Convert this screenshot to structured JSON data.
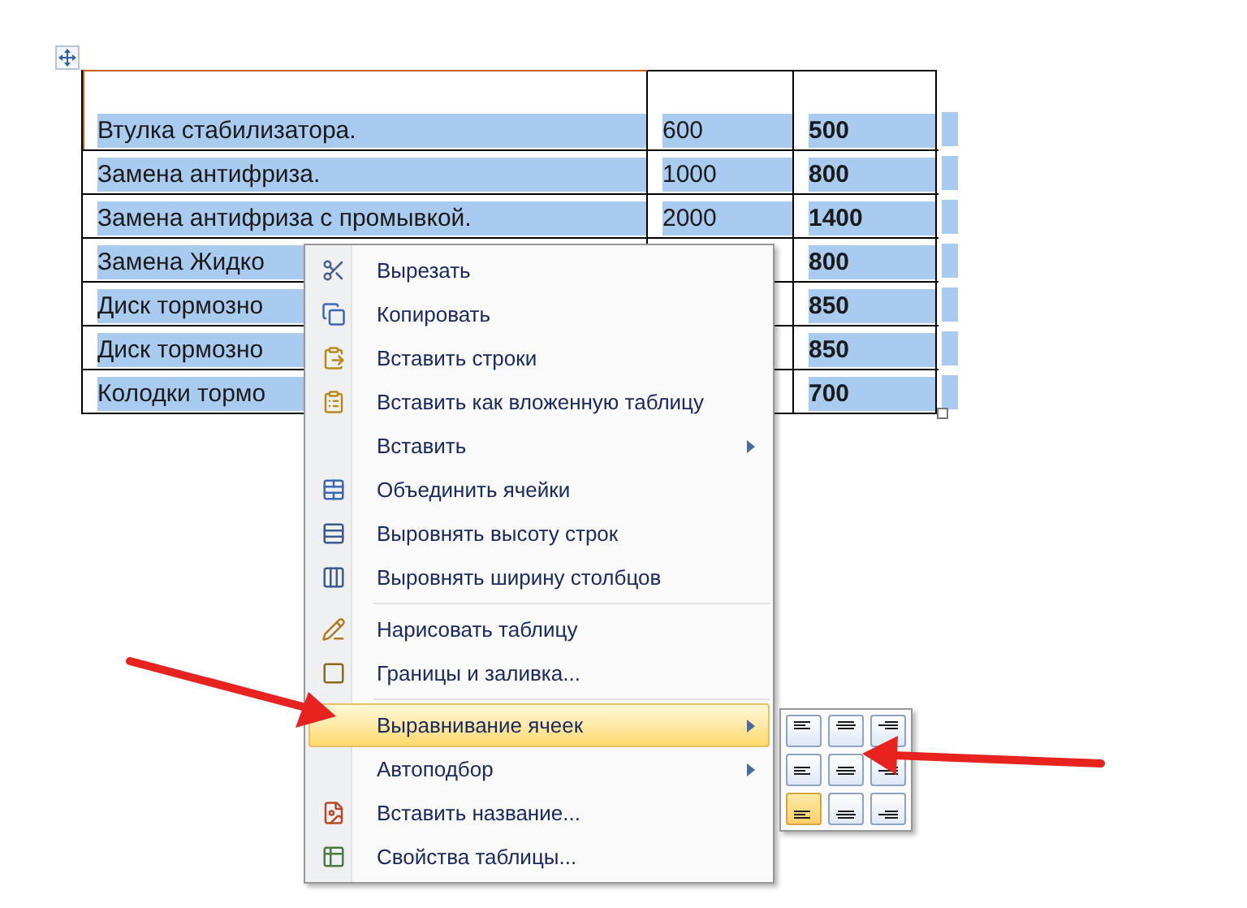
{
  "table": {
    "rows": [
      {
        "name": "Втулка стабилизатора.",
        "price": "600",
        "discount": "500"
      },
      {
        "name": "Замена антифриза.",
        "price": "1000",
        "discount": "800"
      },
      {
        "name": "Замена антифриза с промывкой.",
        "price": "2000",
        "discount": "1400"
      },
      {
        "name": "Замена Жидко",
        "discount": "800"
      },
      {
        "name": "Диск тормозно",
        "discount": "850"
      },
      {
        "name": "Диск тормозно",
        "discount": "850"
      },
      {
        "name": "Колодки тормо",
        "discount": "700"
      }
    ]
  },
  "context_menu": {
    "groups": [
      [
        {
          "label": "Вырезать",
          "submenu": false,
          "selected": false
        },
        {
          "label": "Копировать",
          "submenu": false,
          "selected": false
        },
        {
          "label": "Вставить строки",
          "submenu": false,
          "selected": false
        },
        {
          "label": "Вставить как вложенную таблицу",
          "submenu": false,
          "selected": false
        },
        {
          "label": "Вставить",
          "submenu": true,
          "selected": false
        },
        {
          "label": "Объединить ячейки",
          "submenu": false,
          "selected": false
        },
        {
          "label": "Выровнять высоту строк",
          "submenu": false,
          "selected": false
        },
        {
          "label": "Выровнять ширину столбцов",
          "submenu": false,
          "selected": false
        }
      ],
      [
        {
          "label": "Нарисовать таблицу",
          "submenu": false,
          "selected": false
        },
        {
          "label": "Границы и заливка...",
          "submenu": false,
          "selected": false
        }
      ],
      [
        {
          "label": "Выравнивание ячеек",
          "submenu": true,
          "selected": true
        },
        {
          "label": "Автоподбор",
          "submenu": true,
          "selected": false
        },
        {
          "label": "Вставить название...",
          "submenu": false,
          "selected": false
        },
        {
          "label": "Свойства таблицы...",
          "submenu": false,
          "selected": false
        }
      ]
    ]
  },
  "cell_alignment_submenu": {
    "buttons": [
      {
        "selected": false
      },
      {
        "selected": false
      },
      {
        "selected": false
      },
      {
        "selected": false
      },
      {
        "selected": false
      },
      {
        "selected": false
      },
      {
        "selected": true
      },
      {
        "selected": false
      },
      {
        "selected": false
      }
    ]
  }
}
